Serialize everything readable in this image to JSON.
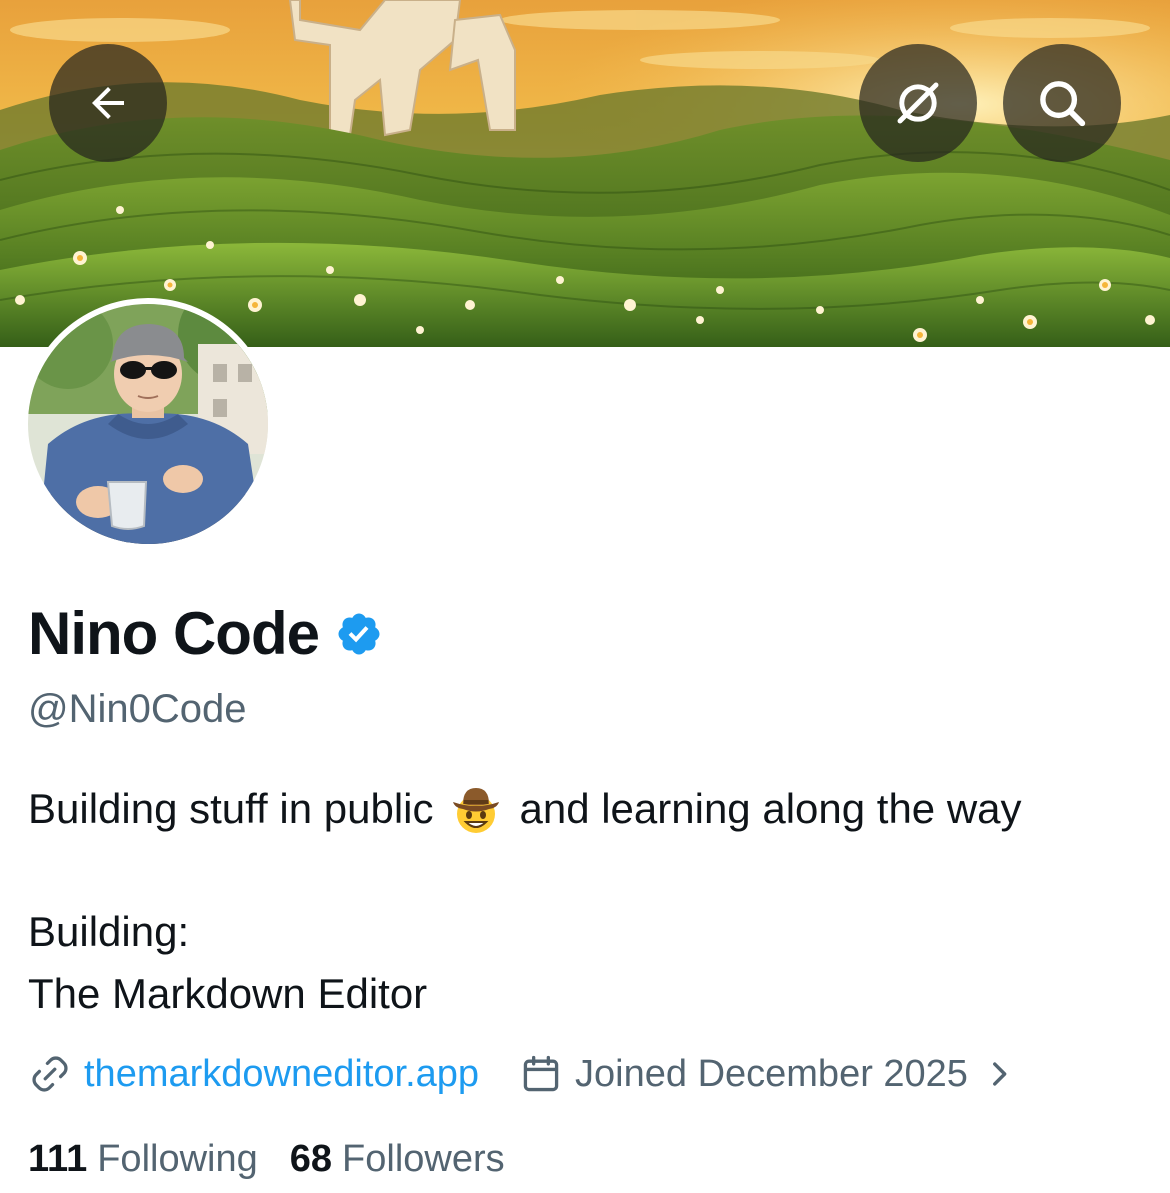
{
  "header": {
    "back_icon": "arrow-left-icon",
    "grok_icon": "grok-icon",
    "search_icon": "search-icon"
  },
  "profile": {
    "display_name": "Nino Code",
    "verified": true,
    "verified_color": "#1d9bf0",
    "handle": "@Nin0Code",
    "bio": {
      "line1_before_emoji": "Building stuff in public",
      "emoji": "cowboy-hat-face",
      "line1_after_emoji": "and learning along the way",
      "line2": "Building:",
      "line3": "The Markdown Editor"
    },
    "website": "themarkdowneditor.app",
    "joined": "Joined December 2025",
    "following_count": "111",
    "following_label": "Following",
    "followers_count": "68",
    "followers_label": "Followers"
  },
  "colors": {
    "text_primary": "#0f1419",
    "text_secondary": "#536471",
    "link": "#1d9bf0"
  }
}
